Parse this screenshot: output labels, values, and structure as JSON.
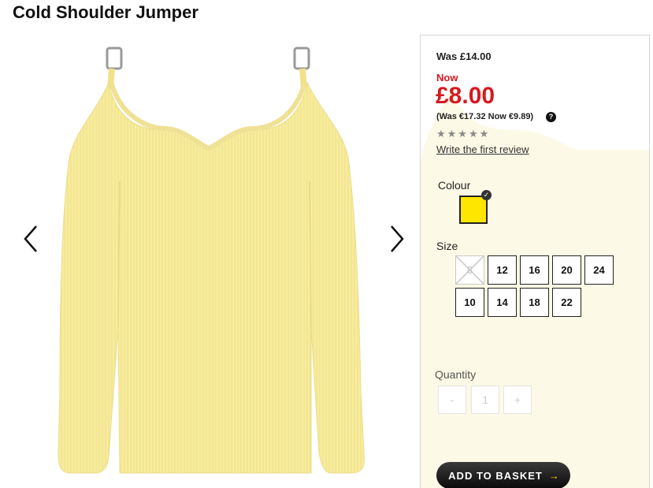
{
  "product": {
    "title": "Cold Shoulder Jumper"
  },
  "pricing": {
    "was": "Was £14.00",
    "now_label": "Now",
    "price": "£8.00",
    "euro": "(Was €17.32 Now €9.89)",
    "help_glyph": "?"
  },
  "rating": {
    "stars": "★★★★★",
    "review_link": "Write the first review"
  },
  "colour": {
    "label": "Colour",
    "selected_hex": "#ffe600"
  },
  "size": {
    "label": "Size",
    "options": [
      {
        "value": "8",
        "available": false
      },
      {
        "value": "12",
        "available": true
      },
      {
        "value": "16",
        "available": true
      },
      {
        "value": "20",
        "available": true
      },
      {
        "value": "24",
        "available": true
      },
      {
        "value": "10",
        "available": true
      },
      {
        "value": "14",
        "available": true
      },
      {
        "value": "18",
        "available": true
      },
      {
        "value": "22",
        "available": true
      }
    ]
  },
  "quantity": {
    "label": "Quantity",
    "minus": "-",
    "value": "1",
    "plus": "+"
  },
  "basket": {
    "label": "ADD TO BASKET",
    "arrow": "→"
  },
  "icons": {
    "prev": "chevron-left-icon",
    "next": "chevron-right-icon",
    "help": "help-icon",
    "selected": "check-icon"
  },
  "colors": {
    "sale_red": "#d71920",
    "jumper_yellow": "#f8ec9d"
  }
}
